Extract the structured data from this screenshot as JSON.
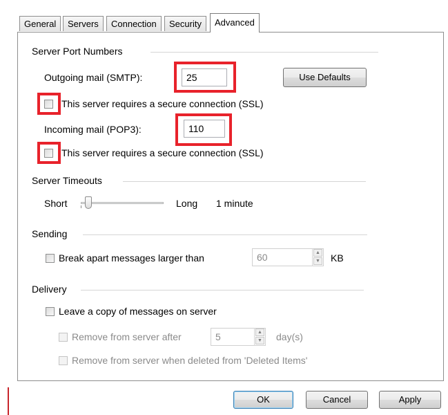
{
  "tabs": [
    {
      "label": "General"
    },
    {
      "label": "Servers"
    },
    {
      "label": "Connection"
    },
    {
      "label": "Security"
    },
    {
      "label": "Advanced"
    }
  ],
  "server_ports": {
    "group_label": "Server Port Numbers",
    "outgoing_label": "Outgoing mail (SMTP):",
    "outgoing_value": "25",
    "use_defaults": "Use Defaults",
    "ssl_outgoing_label": "This server requires a secure connection (SSL)",
    "incoming_label": "Incoming mail (POP3):",
    "incoming_value": "110",
    "ssl_incoming_label": "This server requires a secure connection (SSL)"
  },
  "timeouts": {
    "group_label": "Server Timeouts",
    "short_label": "Short",
    "long_label": "Long",
    "value_label": "1 minute",
    "slider_level": 0.05
  },
  "sending": {
    "group_label": "Sending",
    "break_label": "Break apart messages larger than",
    "size_value": "60",
    "unit": "KB"
  },
  "delivery": {
    "group_label": "Delivery",
    "leave_copy_label": "Leave a copy of messages on server",
    "remove_after_label": "Remove from server after",
    "days_value": "5",
    "days_unit": "day(s)",
    "remove_deleted_label": "Remove from server when deleted from 'Deleted Items'"
  },
  "buttons": {
    "ok": "OK",
    "cancel": "Cancel",
    "apply": "Apply"
  },
  "colors": {
    "highlight": "#e8222b",
    "default_button_border": "#3c7fb1"
  }
}
